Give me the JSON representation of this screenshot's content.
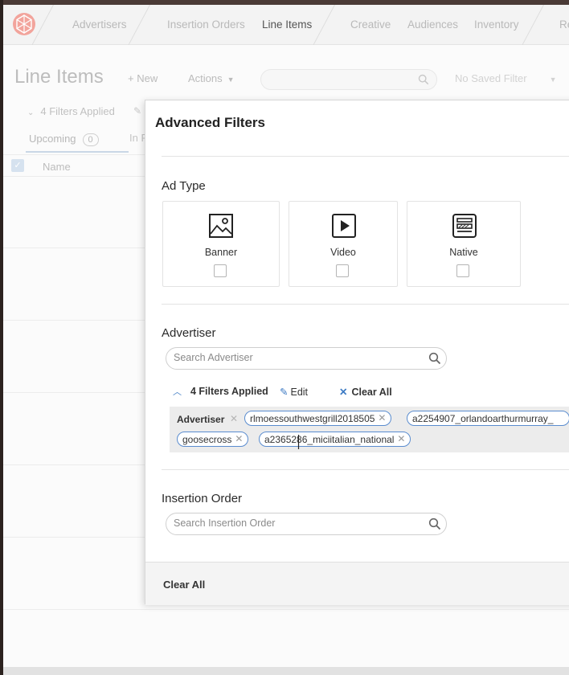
{
  "nav": {
    "items": [
      "Advertisers",
      "Insertion Orders",
      "Line Items",
      "Creative",
      "Audiences",
      "Inventory",
      "Re"
    ],
    "active": "Line Items"
  },
  "page": {
    "title": "Line Items",
    "new_label": "New",
    "actions_label": "Actions",
    "search_placeholder": "",
    "saved_filter_label": "No Saved Filter"
  },
  "background": {
    "filters_applied": "4 Filters Applied",
    "tab_upcoming": "Upcoming",
    "tab_upcoming_count": "0",
    "tab_in": "In P",
    "column_name": "Name"
  },
  "modal": {
    "title": "Advanced Filters",
    "ad_type": {
      "title": "Ad Type",
      "options": [
        {
          "label": "Banner",
          "icon": "image-icon",
          "checked": false
        },
        {
          "label": "Video",
          "icon": "play-icon",
          "checked": false
        },
        {
          "label": "Native",
          "icon": "native-icon",
          "checked": false
        }
      ]
    },
    "advertiser": {
      "title": "Advertiser",
      "search_placeholder": "Search Advertiser",
      "filters_applied": "4 Filters Applied",
      "edit_label": "Edit",
      "clear_all_label": "Clear All",
      "chip_group_label": "Advertiser",
      "chips": [
        "rlmoessouthwestgrill2018505",
        "a2254907_orlandoarthurmurray_",
        "goosecross",
        "a2365286_miciitalian_national"
      ]
    },
    "insertion_order": {
      "title": "Insertion Order",
      "search_placeholder": "Search Insertion Order"
    },
    "footer": {
      "clear_all_label": "Clear All"
    }
  }
}
